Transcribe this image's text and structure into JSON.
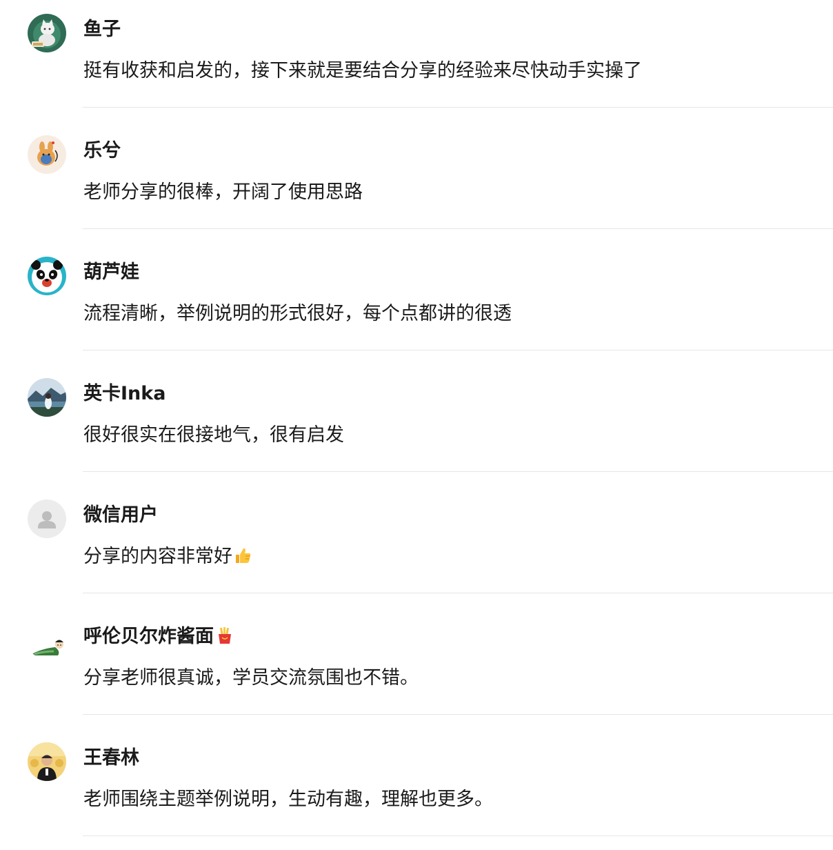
{
  "comments": [
    {
      "nickname": "鱼子",
      "content": "挺有收获和启发的，接下来就是要结合分享的经验来尽快动手实操了",
      "avatar_icon": "cat-reading-avatar-icon"
    },
    {
      "nickname": "乐兮",
      "content": "老师分享的很棒，开阔了使用思路",
      "avatar_icon": "cartoon-rabbit-avatar-icon"
    },
    {
      "nickname": "葫芦娃",
      "content": "流程清晰，举例说明的形式很好，每个点都讲的很透",
      "avatar_icon": "panda-avatar-icon"
    },
    {
      "nickname": "英卡Inka",
      "content": "很好很实在很接地气，很有启发",
      "avatar_icon": "landscape-photo-avatar-icon"
    },
    {
      "nickname": "微信用户",
      "content": "分享的内容非常好",
      "content_emoji": "thumbs-up-emoji-icon",
      "avatar_icon": "default-user-avatar-icon"
    },
    {
      "nickname": "呼伦贝尔炸酱面",
      "nickname_emoji": "french-fries-emoji-icon",
      "content": "分享老师很真诚，学员交流氛围也不错。",
      "avatar_icon": "cartoon-character-avatar-icon"
    },
    {
      "nickname": "王春林",
      "content": "老师围绕主题举例说明，生动有趣，理解也更多。",
      "avatar_icon": "person-photo-avatar-icon"
    }
  ],
  "colors": {
    "text": "#1a1a1a",
    "divider": "#e6e6e6",
    "background": "#ffffff"
  }
}
